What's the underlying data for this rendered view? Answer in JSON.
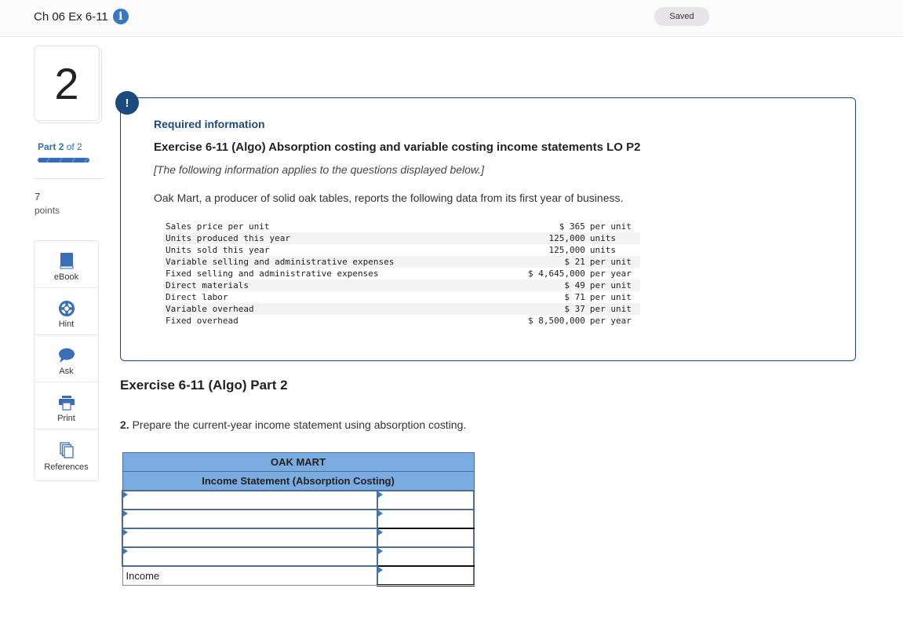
{
  "header": {
    "title": "Ch 06 Ex 6-11",
    "info_icon": "info-icon",
    "status": "Saved"
  },
  "sidebar": {
    "question_number": "2",
    "part_label": "Part",
    "part_current": "2",
    "part_of": "of 2",
    "progress": 1.0,
    "points_value": "7",
    "points_label": "points",
    "tools": [
      {
        "label": "eBook",
        "icon": "book-icon"
      },
      {
        "label": "Hint",
        "icon": "lifebuoy-icon"
      },
      {
        "label": "Ask",
        "icon": "speech-bubble-icon"
      },
      {
        "label": "Print",
        "icon": "printer-icon"
      },
      {
        "label": "References",
        "icon": "documents-icon"
      }
    ]
  },
  "required_info": {
    "badge": "!",
    "heading": "Required information",
    "exercise_title": "Exercise 6-11 (Algo) Absorption costing and variable costing income statements LO P2",
    "note": "[The following information applies to the questions displayed below.]",
    "intro": "Oak Mart, a producer of solid oak tables, reports the following data from its first year of business.",
    "rows": [
      {
        "label": "Sales price per unit",
        "value": "$ 365",
        "unit": "per unit"
      },
      {
        "label": "Units produced this year",
        "value": "125,000",
        "unit": "units"
      },
      {
        "label": "Units sold this year",
        "value": "125,000",
        "unit": "units"
      },
      {
        "label": "Variable selling and administrative expenses",
        "value": "$ 21",
        "unit": "per unit"
      },
      {
        "label": "Fixed selling and administrative expenses",
        "value": "$ 4,645,000",
        "unit": "per year"
      },
      {
        "label": "Direct materials",
        "value": "$ 49",
        "unit": "per unit"
      },
      {
        "label": "Direct labor",
        "value": "$ 71",
        "unit": "per unit"
      },
      {
        "label": "Variable overhead",
        "value": "$ 37",
        "unit": "per unit"
      },
      {
        "label": "Fixed overhead",
        "value": "$ 8,500,000",
        "unit": "per year"
      }
    ]
  },
  "part": {
    "title": "Exercise 6-11 (Algo) Part 2",
    "question_number": "2.",
    "question_text": " Prepare the current-year income statement using absorption costing."
  },
  "worksheet": {
    "company": "OAK MART",
    "statement_title": "Income Statement (Absorption Costing)",
    "rows": [
      {
        "label": "",
        "amount": ""
      },
      {
        "label": "",
        "amount": ""
      },
      {
        "label": "",
        "amount": ""
      },
      {
        "label": "",
        "amount": ""
      }
    ],
    "total_label": "Income",
    "total_amount": ""
  }
}
